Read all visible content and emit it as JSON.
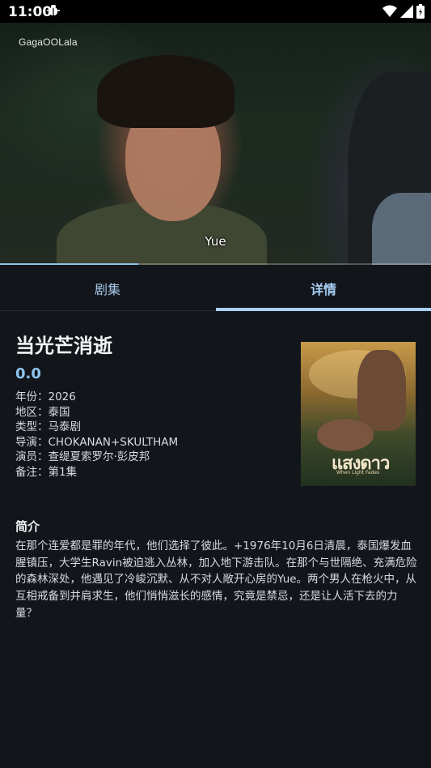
{
  "status_bar": {
    "time": "11:00",
    "icons": [
      "bug-icon",
      "wifi-icon",
      "signal-icon",
      "battery-icon"
    ]
  },
  "video": {
    "logo": "GagaOOLala",
    "subtitle": "Yue",
    "progress_fraction": 0.32
  },
  "tabs": [
    {
      "label": "剧集",
      "active": false
    },
    {
      "label": "详情",
      "active": true
    }
  ],
  "details": {
    "title": "当光芒消逝",
    "score": "0.0",
    "info": [
      "年份：2026",
      "地区：泰国",
      "类型：马泰剧",
      "导演：CHOKANAN+SKULTHAM",
      "演员：查缇夏索罗尔·彭皮邦",
      "备注：第1集"
    ],
    "poster": {
      "title": "แสงดาว",
      "tagline": "When Light Fades"
    },
    "synopsis_heading": "简介",
    "synopsis": "在那个连爱都是罪的年代，他们选择了彼此。+1976年10月6日清晨，泰国爆发血腥镇压，大学生Ravin被迫逃入丛林，加入地下游击队。在那个与世隔绝、充满危险的森林深处，他遇见了冷峻沉默、从不对人敞开心房的Yue。两个男人在枪火中，从互相戒备到并肩求生，他们悄悄滋长的感情，究竟是禁忌，还是让人活下去的力量？"
  },
  "colors": {
    "background": "#12161b",
    "accent": "#a9d0f5",
    "score": "#8fc4ef"
  }
}
